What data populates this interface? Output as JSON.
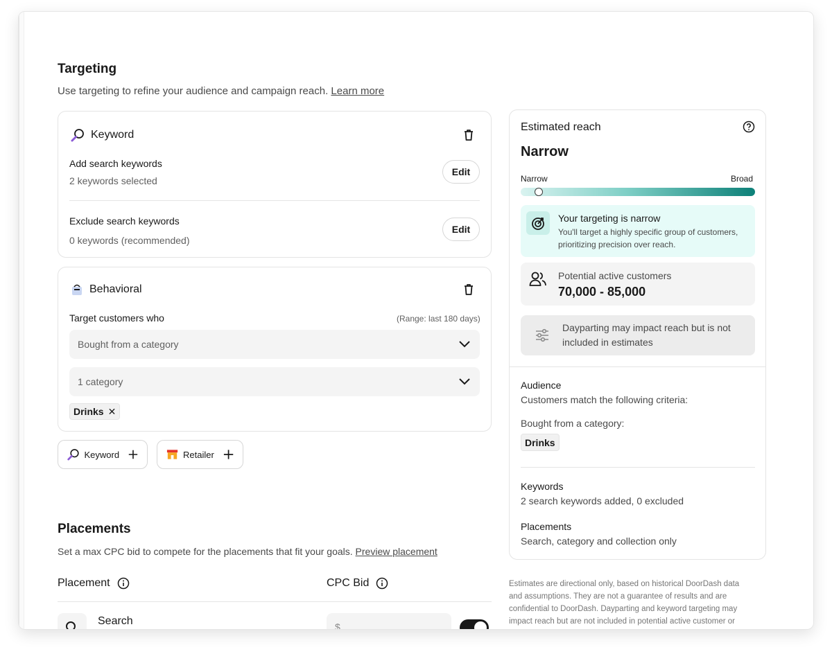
{
  "targeting": {
    "title": "Targeting",
    "subtitle": "Use targeting to refine your audience and campaign reach.",
    "learn_more": "Learn more"
  },
  "keyword_card": {
    "title": "Keyword",
    "add_label": "Add search keywords",
    "add_value": "2 keywords selected",
    "exclude_label": "Exclude search keywords",
    "exclude_value": "0 keywords (recommended)",
    "edit_label": "Edit"
  },
  "behavioral_card": {
    "title": "Behavioral",
    "target_label": "Target customers who",
    "range_note": "(Range: last 180 days)",
    "action_select": "Bought from a category",
    "category_select": "1 category",
    "chip": "Drinks"
  },
  "add_buttons": [
    {
      "label": "Keyword"
    },
    {
      "label": "Retailer"
    }
  ],
  "placements": {
    "title": "Placements",
    "subtitle": "Set a max CPC bid to compete for the placements that fit your goals.",
    "preview_link": "Preview placement",
    "col_placement": "Placement",
    "col_cpc": "CPC Bid",
    "row_search": "Search",
    "cpc_placeholder": "$",
    "search_toggle_on": true
  },
  "reach": {
    "header": "Estimated reach",
    "level": "Narrow",
    "scale_min": "Narrow",
    "scale_max": "Broad",
    "slider_position": 0.06,
    "narrow_title": "Your targeting is narrow",
    "narrow_desc_1": "You'll target a highly specific group of customers,",
    "narrow_desc_2": "prioritizing precision over reach.",
    "potential_label": "Potential active customers",
    "potential_value": "70,000 - 85,000",
    "daypart_1": "Dayparting may impact reach but is not",
    "daypart_2": "included in estimates",
    "audience_title": "Audience",
    "audience_desc": "Customers match the following criteria:",
    "bought_label": "Bought from a category:",
    "bought_chip": "Drinks",
    "keywords_title": "Keywords",
    "keywords_desc": "2 search keywords added, 0 excluded",
    "placements_title": "Placements",
    "placements_desc": "Search, category and collection only"
  },
  "disclaimer": [
    "Estimates are directional only, based on historical DoorDash data",
    "and assumptions. They are not a guarantee of results and are",
    "confidential to DoorDash. Dayparting and keyword targeting may",
    "impact reach but are not included in potential active customer or"
  ],
  "colors": {
    "accent_teal": "#0d8078",
    "info_bg": "#e6fbf8",
    "neutral_bg": "#f4f4f4"
  }
}
